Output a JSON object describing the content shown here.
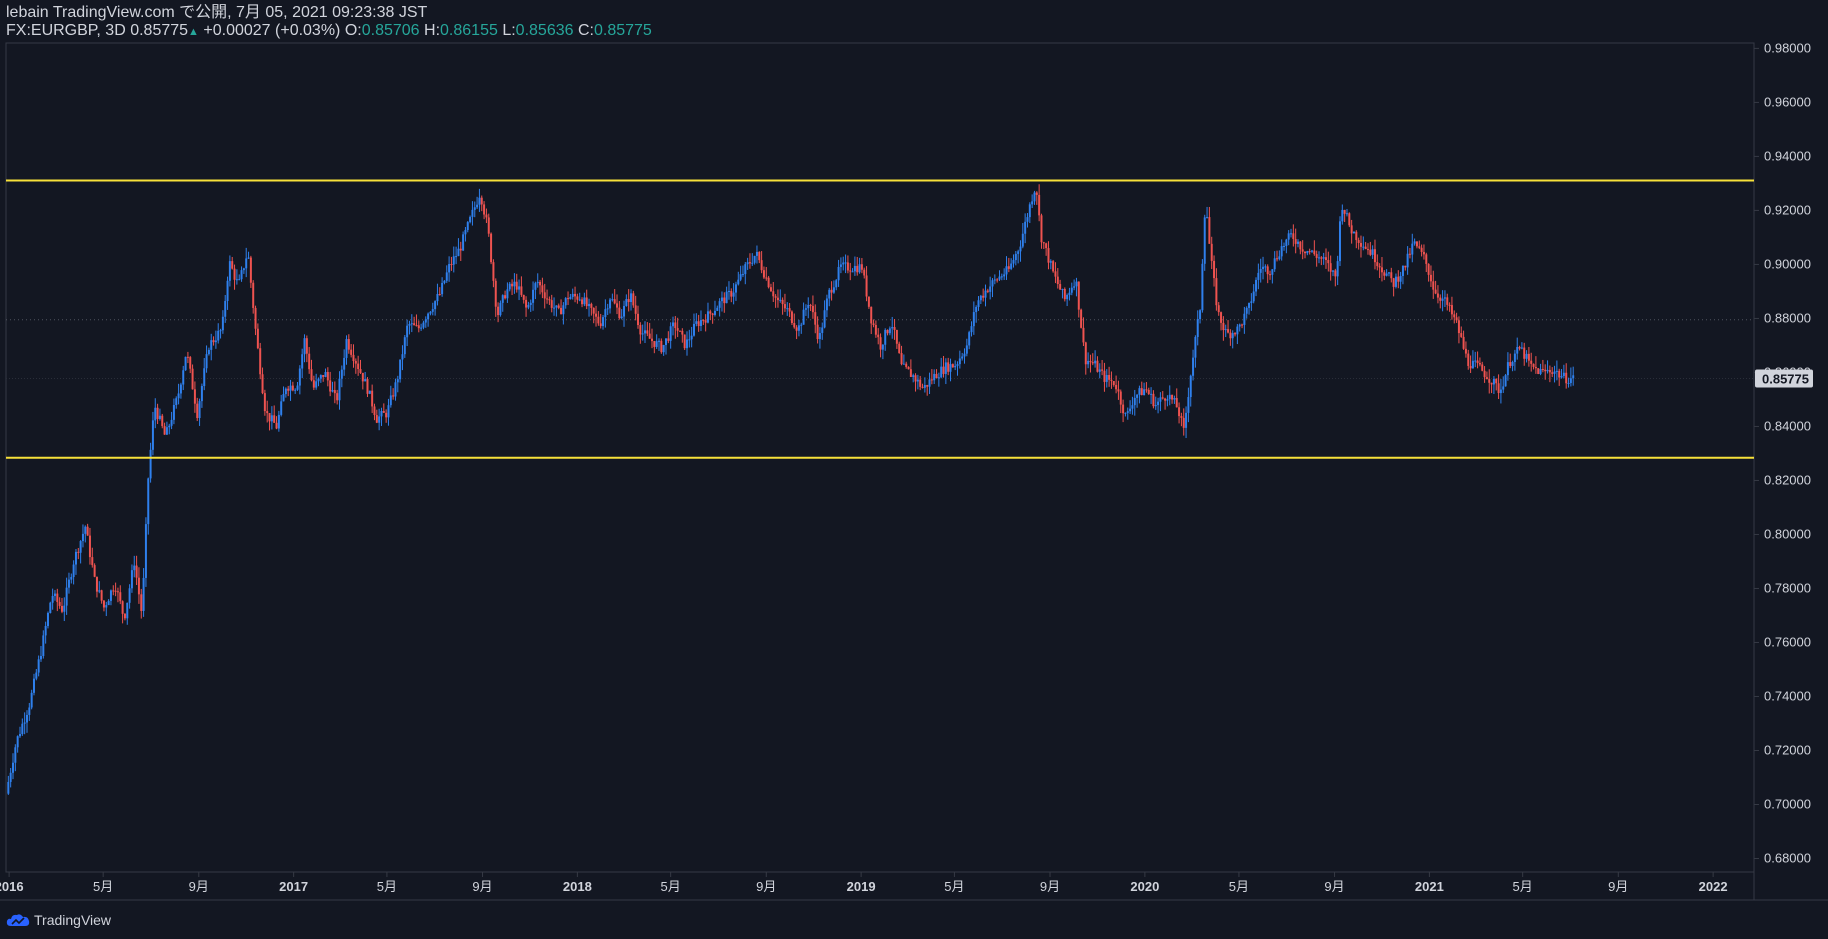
{
  "header": {
    "line1": "lebain TradingView.com で公開, 7月 05, 2021 09:23:38 JST",
    "symbol": "FX:EURGBP, 3D",
    "last": "0.85775",
    "change_arrow": "▲",
    "change": "+0.00027 (+0.03%)",
    "o_label": "O:",
    "o_value": "0.85706",
    "h_label": "H:",
    "h_value": "0.86155",
    "l_label": "L:",
    "l_value": "0.85636",
    "c_label": "C:",
    "c_value": "0.85775"
  },
  "brand": {
    "name": "TradingView",
    "icon": "cloud-logo-icon",
    "color": "#2962ff"
  },
  "colors": {
    "background": "#131722",
    "up": "#2f80ed",
    "down": "#ef5350",
    "hline": "#f7e13a",
    "text": "#d1d4dc",
    "axis": "#363a45",
    "teal": "#26a69a"
  },
  "chart_data": {
    "type": "candlestick",
    "symbol": "FX:EURGBP",
    "interval": "3D",
    "ylim": [
      0.675,
      0.982
    ],
    "y_ticks": [
      "0.98000",
      "0.96000",
      "0.94000",
      "0.92000",
      "0.90000",
      "0.88000",
      "0.86000",
      "0.84000",
      "0.82000",
      "0.80000",
      "0.78000",
      "0.76000",
      "0.74000",
      "0.72000",
      "0.70000",
      "0.68000"
    ],
    "x_ticks": [
      {
        "label": "2016",
        "date": "2016-01-01",
        "year": true
      },
      {
        "label": "5月",
        "date": "2016-05-01",
        "year": false
      },
      {
        "label": "9月",
        "date": "2016-09-01",
        "year": false
      },
      {
        "label": "2017",
        "date": "2017-01-01",
        "year": true
      },
      {
        "label": "5月",
        "date": "2017-05-01",
        "year": false
      },
      {
        "label": "9月",
        "date": "2017-09-01",
        "year": false
      },
      {
        "label": "2018",
        "date": "2018-01-01",
        "year": true
      },
      {
        "label": "5月",
        "date": "2018-05-01",
        "year": false
      },
      {
        "label": "9月",
        "date": "2018-09-01",
        "year": false
      },
      {
        "label": "2019",
        "date": "2019-01-01",
        "year": true
      },
      {
        "label": "5月",
        "date": "2019-05-01",
        "year": false
      },
      {
        "label": "9月",
        "date": "2019-09-01",
        "year": false
      },
      {
        "label": "2020",
        "date": "2020-01-01",
        "year": true
      },
      {
        "label": "5月",
        "date": "2020-05-01",
        "year": false
      },
      {
        "label": "9月",
        "date": "2020-09-01",
        "year": false
      },
      {
        "label": "2021",
        "date": "2021-01-01",
        "year": true
      },
      {
        "label": "5月",
        "date": "2021-05-01",
        "year": false
      },
      {
        "label": "9月",
        "date": "2021-09-01",
        "year": false
      },
      {
        "label": "2022",
        "date": "2022-01-01",
        "year": true
      }
    ],
    "x_start": "2015-12-28",
    "x_end": "2022-02-20",
    "horizontal_lines": [
      0.9311,
      0.8284
    ],
    "dotted_line": 0.8795,
    "last_price": 0.85775,
    "last_price_label": "0.85775",
    "close_path": [
      [
        "2015-12-28",
        0.704
      ],
      [
        "2016-01-10",
        0.723
      ],
      [
        "2016-01-28",
        0.738
      ],
      [
        "2016-02-12",
        0.758
      ],
      [
        "2016-02-25",
        0.778
      ],
      [
        "2016-03-10",
        0.772
      ],
      [
        "2016-03-24",
        0.79
      ],
      [
        "2016-04-08",
        0.803
      ],
      [
        "2016-04-20",
        0.783
      ],
      [
        "2016-05-02",
        0.773
      ],
      [
        "2016-05-16",
        0.782
      ],
      [
        "2016-05-28",
        0.769
      ],
      [
        "2016-06-10",
        0.79
      ],
      [
        "2016-06-20",
        0.77
      ],
      [
        "2016-06-28",
        0.821
      ],
      [
        "2016-07-06",
        0.848
      ],
      [
        "2016-07-20",
        0.836
      ],
      [
        "2016-08-05",
        0.851
      ],
      [
        "2016-08-16",
        0.868
      ],
      [
        "2016-08-30",
        0.845
      ],
      [
        "2016-09-14",
        0.87
      ],
      [
        "2016-10-01",
        0.876
      ],
      [
        "2016-10-10",
        0.901
      ],
      [
        "2016-10-22",
        0.892
      ],
      [
        "2016-11-03",
        0.905
      ],
      [
        "2016-11-14",
        0.873
      ],
      [
        "2016-11-26",
        0.845
      ],
      [
        "2016-12-10",
        0.84
      ],
      [
        "2016-12-22",
        0.855
      ],
      [
        "2017-01-05",
        0.855
      ],
      [
        "2017-01-15",
        0.872
      ],
      [
        "2017-01-26",
        0.854
      ],
      [
        "2017-02-10",
        0.86
      ],
      [
        "2017-02-25",
        0.849
      ],
      [
        "2017-03-10",
        0.872
      ],
      [
        "2017-03-24",
        0.863
      ],
      [
        "2017-04-06",
        0.854
      ],
      [
        "2017-04-18",
        0.843
      ],
      [
        "2017-05-01",
        0.845
      ],
      [
        "2017-05-14",
        0.857
      ],
      [
        "2017-05-28",
        0.878
      ],
      [
        "2017-06-10",
        0.876
      ],
      [
        "2017-06-22",
        0.882
      ],
      [
        "2017-07-08",
        0.889
      ],
      [
        "2017-07-20",
        0.899
      ],
      [
        "2017-08-03",
        0.906
      ],
      [
        "2017-08-18",
        0.918
      ],
      [
        "2017-08-29",
        0.927
      ],
      [
        "2017-09-08",
        0.913
      ],
      [
        "2017-09-20",
        0.881
      ],
      [
        "2017-10-01",
        0.89
      ],
      [
        "2017-10-14",
        0.893
      ],
      [
        "2017-10-28",
        0.883
      ],
      [
        "2017-11-10",
        0.894
      ],
      [
        "2017-11-24",
        0.887
      ],
      [
        "2017-12-08",
        0.882
      ],
      [
        "2017-12-20",
        0.888
      ],
      [
        "2018-01-05",
        0.888
      ],
      [
        "2018-01-17",
        0.883
      ],
      [
        "2018-01-30",
        0.878
      ],
      [
        "2018-02-12",
        0.888
      ],
      [
        "2018-02-26",
        0.881
      ],
      [
        "2018-03-10",
        0.889
      ],
      [
        "2018-03-24",
        0.875
      ],
      [
        "2018-04-06",
        0.872
      ],
      [
        "2018-04-20",
        0.869
      ],
      [
        "2018-05-06",
        0.878
      ],
      [
        "2018-05-20",
        0.87
      ],
      [
        "2018-06-03",
        0.878
      ],
      [
        "2018-06-18",
        0.881
      ],
      [
        "2018-07-04",
        0.886
      ],
      [
        "2018-07-20",
        0.89
      ],
      [
        "2018-08-06",
        0.899
      ],
      [
        "2018-08-19",
        0.904
      ],
      [
        "2018-09-01",
        0.895
      ],
      [
        "2018-09-14",
        0.887
      ],
      [
        "2018-09-28",
        0.883
      ],
      [
        "2018-10-12",
        0.876
      ],
      [
        "2018-10-26",
        0.887
      ],
      [
        "2018-11-08",
        0.872
      ],
      [
        "2018-11-20",
        0.889
      ],
      [
        "2018-12-06",
        0.899
      ],
      [
        "2018-12-20",
        0.899
      ],
      [
        "2019-01-02",
        0.899
      ],
      [
        "2019-01-14",
        0.88
      ],
      [
        "2019-01-26",
        0.87
      ],
      [
        "2019-02-09",
        0.879
      ],
      [
        "2019-02-22",
        0.862
      ],
      [
        "2019-03-08",
        0.859
      ],
      [
        "2019-03-22",
        0.854
      ],
      [
        "2019-04-06",
        0.859
      ],
      [
        "2019-04-20",
        0.862
      ],
      [
        "2019-05-03",
        0.863
      ],
      [
        "2019-05-17",
        0.87
      ],
      [
        "2019-05-30",
        0.886
      ],
      [
        "2019-06-12",
        0.891
      ],
      [
        "2019-06-26",
        0.895
      ],
      [
        "2019-07-10",
        0.898
      ],
      [
        "2019-07-24",
        0.907
      ],
      [
        "2019-08-07",
        0.923
      ],
      [
        "2019-08-14",
        0.93
      ],
      [
        "2019-08-20",
        0.911
      ],
      [
        "2019-09-06",
        0.896
      ],
      [
        "2019-09-20",
        0.887
      ],
      [
        "2019-10-04",
        0.895
      ],
      [
        "2019-10-16",
        0.865
      ],
      [
        "2019-10-28",
        0.863
      ],
      [
        "2019-11-10",
        0.858
      ],
      [
        "2019-11-24",
        0.856
      ],
      [
        "2019-12-08",
        0.843
      ],
      [
        "2019-12-18",
        0.851
      ],
      [
        "2020-01-02",
        0.854
      ],
      [
        "2020-01-15",
        0.848
      ],
      [
        "2020-01-30",
        0.852
      ],
      [
        "2020-02-12",
        0.847
      ],
      [
        "2020-02-20",
        0.838
      ],
      [
        "2020-03-01",
        0.862
      ],
      [
        "2020-03-12",
        0.884
      ],
      [
        "2020-03-19",
        0.925
      ],
      [
        "2020-03-25",
        0.904
      ],
      [
        "2020-04-04",
        0.882
      ],
      [
        "2020-04-15",
        0.874
      ],
      [
        "2020-04-30",
        0.876
      ],
      [
        "2020-05-14",
        0.884
      ],
      [
        "2020-05-28",
        0.899
      ],
      [
        "2020-06-10",
        0.898
      ],
      [
        "2020-06-24",
        0.906
      ],
      [
        "2020-07-08",
        0.911
      ],
      [
        "2020-07-22",
        0.906
      ],
      [
        "2020-08-05",
        0.904
      ],
      [
        "2020-08-20",
        0.901
      ],
      [
        "2020-09-03",
        0.895
      ],
      [
        "2020-09-10",
        0.923
      ],
      [
        "2020-09-22",
        0.913
      ],
      [
        "2020-10-06",
        0.908
      ],
      [
        "2020-10-20",
        0.904
      ],
      [
        "2020-11-02",
        0.898
      ],
      [
        "2020-11-16",
        0.893
      ],
      [
        "2020-11-30",
        0.899
      ],
      [
        "2020-12-12",
        0.908
      ],
      [
        "2020-12-26",
        0.902
      ],
      [
        "2021-01-08",
        0.89
      ],
      [
        "2021-01-22",
        0.886
      ],
      [
        "2021-02-05",
        0.878
      ],
      [
        "2021-02-19",
        0.864
      ],
      [
        "2021-03-05",
        0.862
      ],
      [
        "2021-03-19",
        0.858
      ],
      [
        "2021-04-02",
        0.853
      ],
      [
        "2021-04-14",
        0.864
      ],
      [
        "2021-04-28",
        0.869
      ],
      [
        "2021-05-12",
        0.862
      ],
      [
        "2021-05-26",
        0.86
      ],
      [
        "2021-06-09",
        0.861
      ],
      [
        "2021-06-23",
        0.858
      ],
      [
        "2021-07-05",
        0.85775
      ]
    ]
  }
}
